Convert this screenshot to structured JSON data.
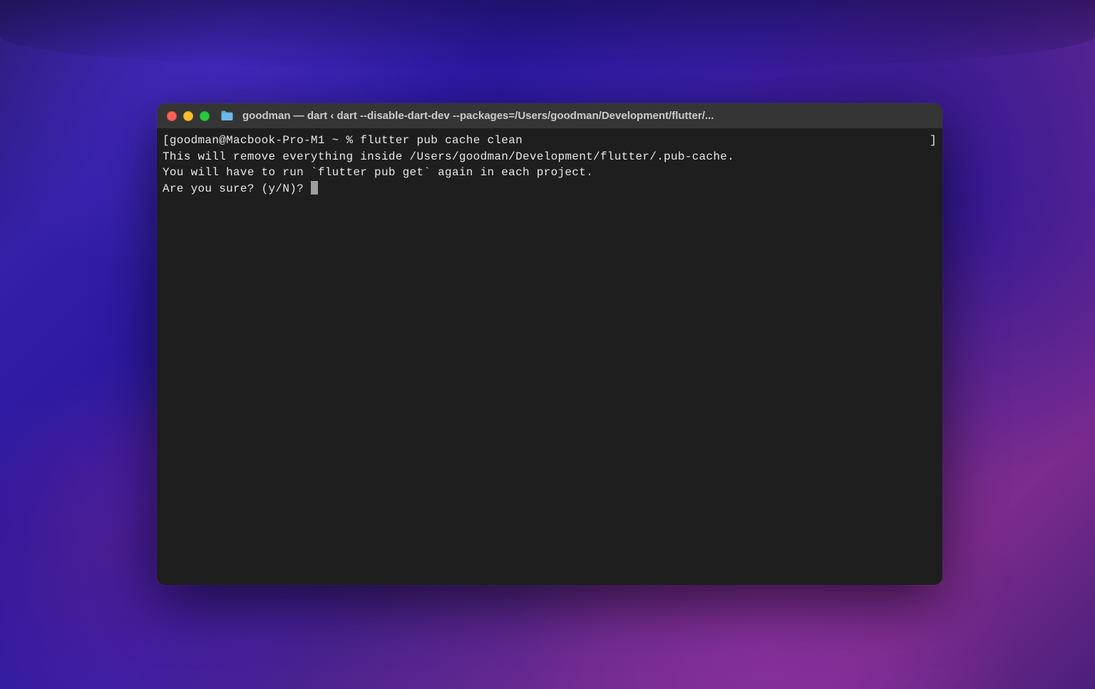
{
  "window": {
    "title": "goodman — dart ‹ dart --disable-dart-dev --packages=/Users/goodman/Development/flutter/..."
  },
  "terminal": {
    "prompt_open": "[",
    "prompt_user_host": "goodman@Macbook-Pro-M1",
    "prompt_path": " ~ % ",
    "command": "flutter pub cache clean",
    "line2": "This will remove everything inside /Users/goodman/Development/flutter/.pub-cache.",
    "line3": "You will have to run `flutter pub get` again in each project.",
    "line4": "Are you sure? (y/N)? ",
    "right_bracket": "]"
  }
}
